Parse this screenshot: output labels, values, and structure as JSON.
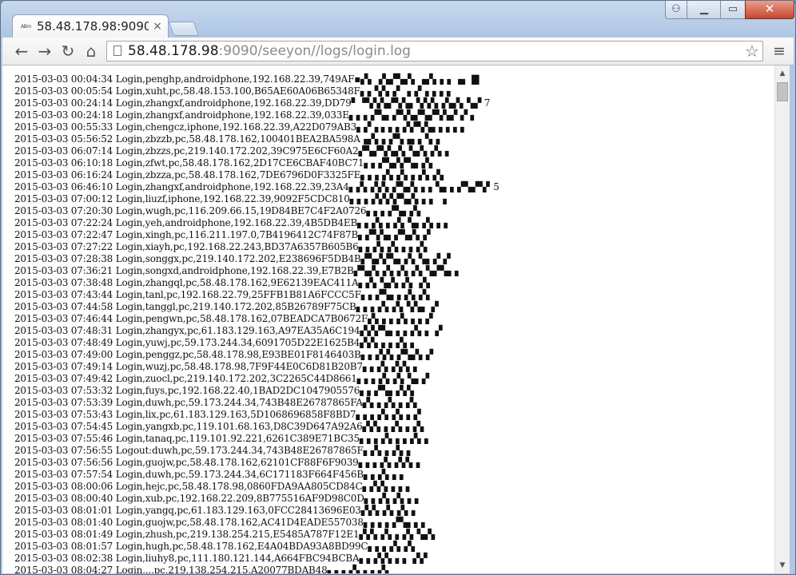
{
  "tab": {
    "favicon_text": "ABm",
    "title": "58.48.178.98:9090/",
    "close": "×"
  },
  "window_controls": {
    "user": "⚇",
    "minimize": "▁",
    "maximize": "▭",
    "close": "✕"
  },
  "toolbar": {
    "back": "←",
    "forward": "→",
    "reload": "↻",
    "home": "⌂",
    "url_host": "58.48.178.98",
    "url_rest": ":9090/seeyon//logs/login.log",
    "star": "☆",
    "menu": "≡"
  },
  "log_lines": [
    "2015-03-03 00:04:34 Login,penghp,androidphone,192.168.22.39,749AF▪▞▖▗▚▞▚▞▖▗▞▖▖▖▗▖ ▇",
    "2015-03-03 00:05:54 Login,xuht,pc,58.48.153.100,B65AE60A06B65348F▖▖▚▚▗▘▗▗▘▖▖▖▖",
    "2015-03-03 00:24:14 Login,zhangxf,androidphone,192.168.22.39,DD79▘▝▚▚▚▞▚▚▖▚▚▚▗▚▞▖▚▞ 7",
    "2015-03-03 00:24:18 Login,zhangxf,androidphone,192.168.22.39,033E▖▖▖▞▚▖▞▚▚▞▚▞▚▚▞ ▞ ▖",
    "2015-03-03 00:55:33 Login,chengcz,iphone,192.168.22.39,A22D079AB3▖▞▗ ▖▖▖▞▞▚▚▖▖▖▖▖",
    "2015-03-03 05:56:52 Login,zbzzb,pc,58.48.178.162,100401BEA2BA598A▗▞▖▖▞▚▗▖▖▚▗",
    "2015-03-03 06:07:14 Login,zbzzs,pc,219.140.172.202,39C975E6CF60A2▞▚▞▚▚▞▖▚▞▖▞▖▖",
    "2015-03-03 06:10:18 Login,zfwt,pc,58.48.178.162,2D17CE6CBAF40BC71▖▖▞▚▞▞▚▖▞▖",
    "2015-03-03 06:16:24 Login,zbzza,pc,58.48.178.162,7DE6796D0F3325FE▖▖▖▞▖▞▖▖▞▖▞▖",
    "2015-03-03 06:46:10 Login,zhangxf,androidphone,192.168.22.39,23A4▖▞▖▞▞▖▞▚▞▖▖▖▚▖▖▞▚▞▚▘5",
    "2015-03-03 07:00:12 Login,liuzf,iphone,192.168.22.39,9092F5CDC810▖▖▖▞▞▞▞▚▞▖▖▖ ▗",
    "2015-03-03 07:20:30 Login,wugh,pc,116.209.66.15,19D84BE7C4F2A0726▖▖▖▞▚▖▞▖",
    "2015-03-03 07:22:24 Login,yeh,androidphone,192.168.22.39,4B5DB4EB▖▖▞▖▖▞▖▚▖▞▖▖▖",
    "2015-03-03 07:22:47 Login,xingh,pc,116.211.197.0,7B4196412C74F87B▖▞▚▚▖▞▚▞▖▞",
    "2015-03-03 07:27:22 Login,xiayh,pc,192.168.22.243,BD37A6357B605B6▖▖▞▖▞▖▖▖▞▖",
    "2015-03-03 07:28:38 Login,songgx,pc,219.140.172.202,E238696F5DB4B▞▚▞▞▚▖▞▖▚▖▞ ▞",
    "2015-03-03 07:36:21 Login,songxd,androidphone,192.168.22.39,E7B2B▞▚▞▖▞▖▞▖▞▖▚▞▚▖▖",
    "2015-03-03 07:38:48 Login,zhangql,pc,58.48.178.162,9E62139EAC411A▖▞▖▚▞▖▞▖ ▞▖",
    "2015-03-03 07:43:44 Login,tanl,pc,192.168.22.79,25FFB1B81A6FCCC5F▖▖▞▚▖▖▞▖▞▖",
    "2015-03-03 07:44:58 Login,tanggl,pc,219.140.172.202,85B26789F75CB▖▖▖▞▖▞▖▚▚▖ ▞",
    "2015-03-03 07:46:44 Login,pengwn,pc,58.48.178.162,07BEADCA7B0672F▞▖▖▖▞▖▖▖▞",
    "2015-03-03 07:48:31 Login,zhangyx,pc,61.183.129.163,A97EA35A6C194▞▞▞▚▖▖▖▞▖▖ ▞",
    "2015-03-03 07:48:49 Login,yuwj,pc,59.173.244.34,6091705D22E1625B4▞▞▖▖▖▞▖▖",
    "2015-03-03 07:49:00 Login,penggz,pc,58.48.178.98,E93BE01F8146403B▖▖▞▞▖▞▚▞▖▞",
    "2015-03-03 07:49:14 Login,wuzj,pc,58.48.178.98,7F9F44E0C6D81B20B7▖▖▞▖▞▞▖▖",
    "2015-03-03 07:49:42 Login,zuocl,pc,219.140.172.202,3C2265C44D8661▖▖▖▞▖▞▖▚▖▞",
    "2015-03-03 07:53:32 Login,fuys,pc,192.168.22.40,1BAD2DC1047905576▖▖▞▚▖▞▞▖",
    "2015-03-03 07:53:39 Login,duwh,pc,59.173.244.34,743B48E26787865FA▞▖▖▞▖▖▞▖",
    "2015-03-03 07:53:43 Login,lix,pc,61.183.129.163,5D1068696858F8BD7▖▖▖▞▖▞▖▖▞",
    "2015-03-03 07:54:45 Login,yangxb,pc,119.101.68.163,D8C39D647A92A6▞▞▖▖▞▖▖▞▖",
    "2015-03-03 07:55:46 Login,tanaq,pc,119.101.92.221,6261C389E71BC35▖▖▖▞▖▖▖▞▖▖",
    "2015-03-03 07:56:55 Logout:duwh,pc,59.173.244.34,743B48E26787865F▖▞▖▖▞▖▖",
    "2015-03-03 07:56:56 Login,guojw,pc,58.48.178.162,62101CF88F6F9039▖▖▖▞▖▞▞▖▖",
    "2015-03-03 07:57:54 Login,duwh,pc,59.173.244.34,6C171183F664F456B▖▖▞▖▖▖",
    "2015-03-03 08:00:06 Login,hejc,pc,58.48.178.98,0860FDA9AA805CD84C▖▞▞▖▖▖▖",
    "2015-03-03 08:00:40 Login,xub,pc,192.168.22.209,8B775516AF9D98C0D▖▖▞▖▞▖▖▖",
    "2015-03-03 08:01:01 Login,yangq,pc,61.183.129.163,0FCC28413696E03▞▞▖▞▖▞▖▖",
    "2015-03-03 08:01:40 Login,guojw,pc,58.48.178.162,AC41D4EADE557038▖▖▖▖▞▚▖▖▖",
    "2015-03-03 08:01:49 Login,zhush,pc,219.138.254.215,E5485A787F12E1▞▞▖▞▖▖▞▖▚▞▖",
    "2015-03-03 08:01:57 Login,hugh,pc,58.48.178.162,E4A04BDA93A8BD99C▖▖▖▞▖▞▖",
    "2015-03-03 08:02:38 Login,liuhy8,pc,111.180.121.144,A664FBC94BCBA▖▖▞▞▖▖▖ ▞▞",
    "2015-03-03 08:04:27 Login,..,pc,219.138.254.215,A20077BDAB48▖▖▖▞▖▖▖▞▖"
  ]
}
